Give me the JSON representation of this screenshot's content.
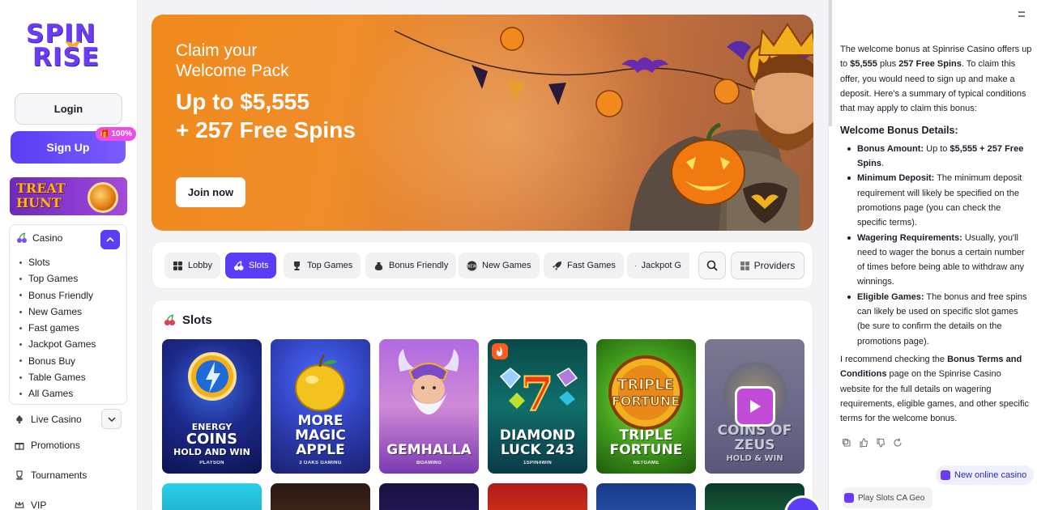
{
  "brand": {
    "logo_line1": "SPIN",
    "logo_line2": "RISE",
    "accent": "#5b3df5"
  },
  "sidebar": {
    "login_label": "Login",
    "signup_label": "Sign Up",
    "signup_badge": "100%",
    "promo_banner": {
      "line1": "TREAT",
      "line2": "HUNT"
    },
    "casino_label": "Casino",
    "casino_items": [
      "Slots",
      "Top Games",
      "Bonus Friendly",
      "New Games",
      "Fast games",
      "Jackpot Games",
      "Bonus Buy",
      "Table Games",
      "All Games"
    ],
    "live_casino_label": "Live Casino",
    "promotions_label": "Promotions",
    "tournaments_label": "Tournaments",
    "vip_label": "VIP"
  },
  "hero": {
    "claim_line1": "Claim your",
    "claim_line2": "Welcome Pack",
    "amount_line1": "Up to $5,555",
    "amount_line2": "+ 257 Free Spins",
    "join_label": "Join now"
  },
  "tabs": [
    {
      "label": "Lobby",
      "icon": "grid-icon",
      "active": false
    },
    {
      "label": "Slots",
      "icon": "cherries-icon",
      "active": true
    },
    {
      "label": "Top Games",
      "icon": "trophy-icon",
      "active": false
    },
    {
      "label": "Bonus Friendly",
      "icon": "money-bag-icon",
      "active": false
    },
    {
      "label": "New Games",
      "icon": "new-icon",
      "active": false
    },
    {
      "label": "Fast Games",
      "icon": "rocket-icon",
      "active": false
    },
    {
      "label": "Jackpot G",
      "icon": "jackpot-icon",
      "active": false
    }
  ],
  "providers_label": "Providers",
  "slots": {
    "title": "Slots",
    "games": [
      {
        "title_top": "ENERGY",
        "title": "COINS",
        "subtitle": "HOLD AND WIN",
        "provider": "PLAYSON",
        "bg": "#1d2a8c"
      },
      {
        "title_top": "",
        "title": "MORE MAGIC APPLE",
        "subtitle": "",
        "provider": "3 OAKS GAMING",
        "bg": "#2f3fb8"
      },
      {
        "title_top": "",
        "title": "GEMHALLA",
        "subtitle": "",
        "provider": "BGAMING",
        "bg": "#8b4fc8"
      },
      {
        "title_top": "",
        "title": "DIAMOND LUCK 243",
        "subtitle": "",
        "provider": "1SPIN4WIN",
        "bg": "#0f6f6a"
      },
      {
        "title_top": "",
        "title": "TRIPLE FORTUNE",
        "subtitle": "",
        "provider": "NETGAME",
        "bg": "#3f9a1c"
      },
      {
        "title_top": "",
        "title": "COINS OF ZEUS",
        "subtitle": "HOLD & WIN",
        "provider": "",
        "bg": "#6b6a8c"
      }
    ]
  },
  "chat": {
    "intro_1": "The welcome bonus at Spinrise Casino offers up to ",
    "intro_amount": "$5,555",
    "intro_2": " plus ",
    "intro_spins": "257 Free Spins",
    "intro_3": ". To claim this offer, you would need to sign up and make a deposit. Here's a summary of typical conditions that may apply to claim this bonus:",
    "heading": "Welcome Bonus Details:",
    "bullets": [
      {
        "label": "Bonus Amount:",
        "text": " Up to ",
        "strong": "$5,555 + 257 Free Spins",
        "tail": "."
      },
      {
        "label": "Minimum Deposit:",
        "text": " The minimum deposit requirement will likely be specified on the promotions page (you can check the specific terms).",
        "strong": "",
        "tail": ""
      },
      {
        "label": "Wagering Requirements:",
        "text": " Usually, you'll need to wager the bonus a certain number of times before being able to withdraw any winnings.",
        "strong": "",
        "tail": ""
      },
      {
        "label": "Eligible Games:",
        "text": " The bonus and free spins can likely be used on specific slot games (be sure to confirm the details on the promotions page).",
        "strong": "",
        "tail": ""
      }
    ],
    "outro_1": "I recommend checking the ",
    "outro_strong": "Bonus Terms and Conditions",
    "outro_2": " page on the Spinrise Casino website for the full details on wagering requirements, eligible games, and other specific terms for the welcome bonus.",
    "suggestion_1": "New online casino",
    "suggestion_2": "Play Slots CA Geo"
  }
}
